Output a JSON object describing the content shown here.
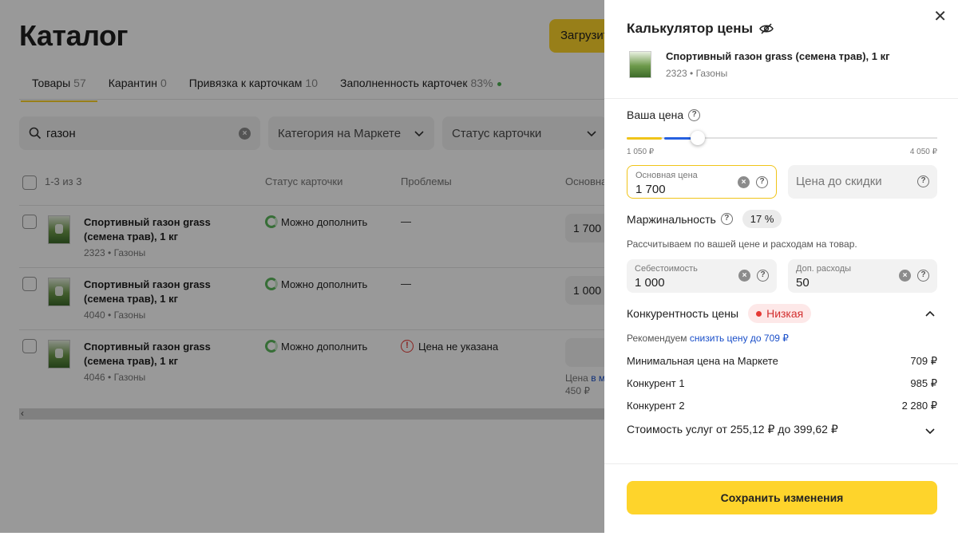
{
  "catalog": {
    "title": "Каталог",
    "upload_button": "Загрузить",
    "tabs": [
      {
        "label": "Товары",
        "count": "57"
      },
      {
        "label": "Карантин",
        "count": "0"
      },
      {
        "label": "Привязка к карточкам",
        "count": "10"
      },
      {
        "label": "Заполненность карточек",
        "count": "83%"
      }
    ],
    "search_value": "газон",
    "filters": [
      "Категория на Маркете",
      "Статус карточки"
    ],
    "table_headers": {
      "range": "1-3 из 3",
      "status": "Статус карточки",
      "problems": "Проблемы",
      "price": "Основна"
    },
    "rows": [
      {
        "name": "Спортивный газон grass (семена трав), 1 кг",
        "sku": "2323 • Газоны",
        "status": "Можно дополнить",
        "problem": "—",
        "price": "1 700"
      },
      {
        "name": "Спортивный газон grass (семена трав), 1 кг",
        "sku": "4040 • Газоны",
        "status": "Можно дополнить",
        "problem": "—",
        "price": "1 000"
      },
      {
        "name": "Спортивный газон grass (семена трав), 1 кг",
        "sku": "4046 • Газоны",
        "status": "Можно дополнить",
        "problem": "Цена не указана",
        "price": "",
        "note_prefix": "Цена",
        "note_link": "в м",
        "note_value": "450 ₽"
      }
    ]
  },
  "panel": {
    "title": "Калькулятор цены",
    "product_name": "Спортивный газон grass (семена трав), 1 кг",
    "product_sku": "2323 • Газоны",
    "your_price_label": "Ваша цена",
    "slider_min": "1 050 ₽",
    "slider_max": "4 050 ₽",
    "slider_level": 0.22,
    "base_price_label": "Основная цена",
    "base_price_value": "1 700",
    "price_before_discount_placeholder": "Цена до скидки",
    "margin_label": "Маржинальность",
    "margin_value": "17 %",
    "margin_note": "Рассчитываем по вашей цене и расходам на товар.",
    "cost_label": "Себестоимость",
    "cost_value": "1 000",
    "extra_label": "Доп. расходы",
    "extra_value": "50",
    "competitiveness_label": "Конкурентность цены",
    "competitiveness_value": "Низкая",
    "recommend_prefix": "Рекомендуем",
    "recommend_link": "снизить цену до 709 ₽",
    "competitors": [
      {
        "label": "Минимальная цена на Маркете",
        "value": "709 ₽"
      },
      {
        "label": "Конкурент 1",
        "value": "985 ₽"
      },
      {
        "label": "Конкурент 2",
        "value": "2 280 ₽"
      }
    ],
    "services_cost": "Стоимость услуг от 255,12 ₽ до 399,62 ₽",
    "save_button": "Сохранить изменения"
  },
  "colors": {
    "accent_yellow": "#fed42b",
    "slider_blue": "#2660e0",
    "low_red": "#d32f2f"
  }
}
